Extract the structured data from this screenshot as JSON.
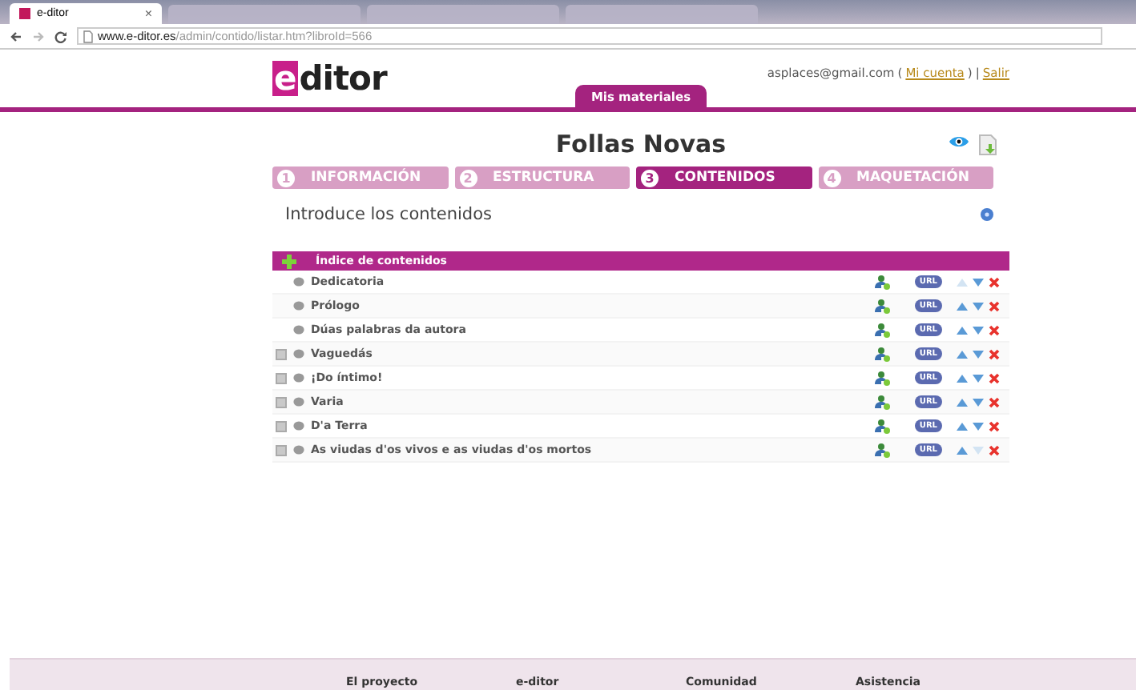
{
  "browser": {
    "tab_title": "e-ditor",
    "tab_close": "×",
    "url_host": "www.e-ditor.es",
    "url_path": "/admin/contido/listar.htm?libroId=566"
  },
  "header": {
    "logo_mark": "e",
    "logo_text": "ditor",
    "user_email": "asplaces@gmail.com",
    "account_open": "(",
    "account_link": "Mi cuenta",
    "account_close": ")",
    "separator": "|",
    "logout_link": "Salir",
    "nav_tab": "Mis materiales"
  },
  "book_title": "Follas Novas",
  "steps": [
    {
      "number": "1",
      "label": "INFORMACIÓN",
      "selected": false
    },
    {
      "number": "2",
      "label": "ESTRUCTURA",
      "selected": false
    },
    {
      "number": "3",
      "label": "CONTENIDOS",
      "selected": true
    },
    {
      "number": "4",
      "label": "MAQUETACIÓN",
      "selected": false
    }
  ],
  "instructions": "Introduce los contenidos",
  "table": {
    "header": "Índice de contenidos",
    "rows": [
      {
        "title": "Dedicatoria",
        "url_badge": "URL",
        "expandable": false,
        "can_move_up": false,
        "can_move_down": true
      },
      {
        "title": "Prólogo",
        "url_badge": "URL",
        "expandable": false,
        "can_move_up": true,
        "can_move_down": true
      },
      {
        "title": "Dúas palabras da autora",
        "url_badge": "URL",
        "expandable": false,
        "can_move_up": true,
        "can_move_down": true
      },
      {
        "title": "Vaguedás",
        "url_badge": "URL",
        "expandable": true,
        "can_move_up": true,
        "can_move_down": true
      },
      {
        "title": "¡Do íntimo!",
        "url_badge": "URL",
        "expandable": true,
        "can_move_up": true,
        "can_move_down": true
      },
      {
        "title": "Varia",
        "url_badge": "URL",
        "expandable": true,
        "can_move_up": true,
        "can_move_down": true
      },
      {
        "title": "D'a Terra",
        "url_badge": "URL",
        "expandable": true,
        "can_move_up": true,
        "can_move_down": true
      },
      {
        "title": "As viudas d'os vivos e as viudas d'os mortos",
        "url_badge": "URL",
        "expandable": true,
        "can_move_up": true,
        "can_move_down": false
      }
    ]
  },
  "footer": {
    "links": [
      "El proyecto",
      "e-ditor",
      "Comunidad",
      "Asistencia"
    ]
  }
}
